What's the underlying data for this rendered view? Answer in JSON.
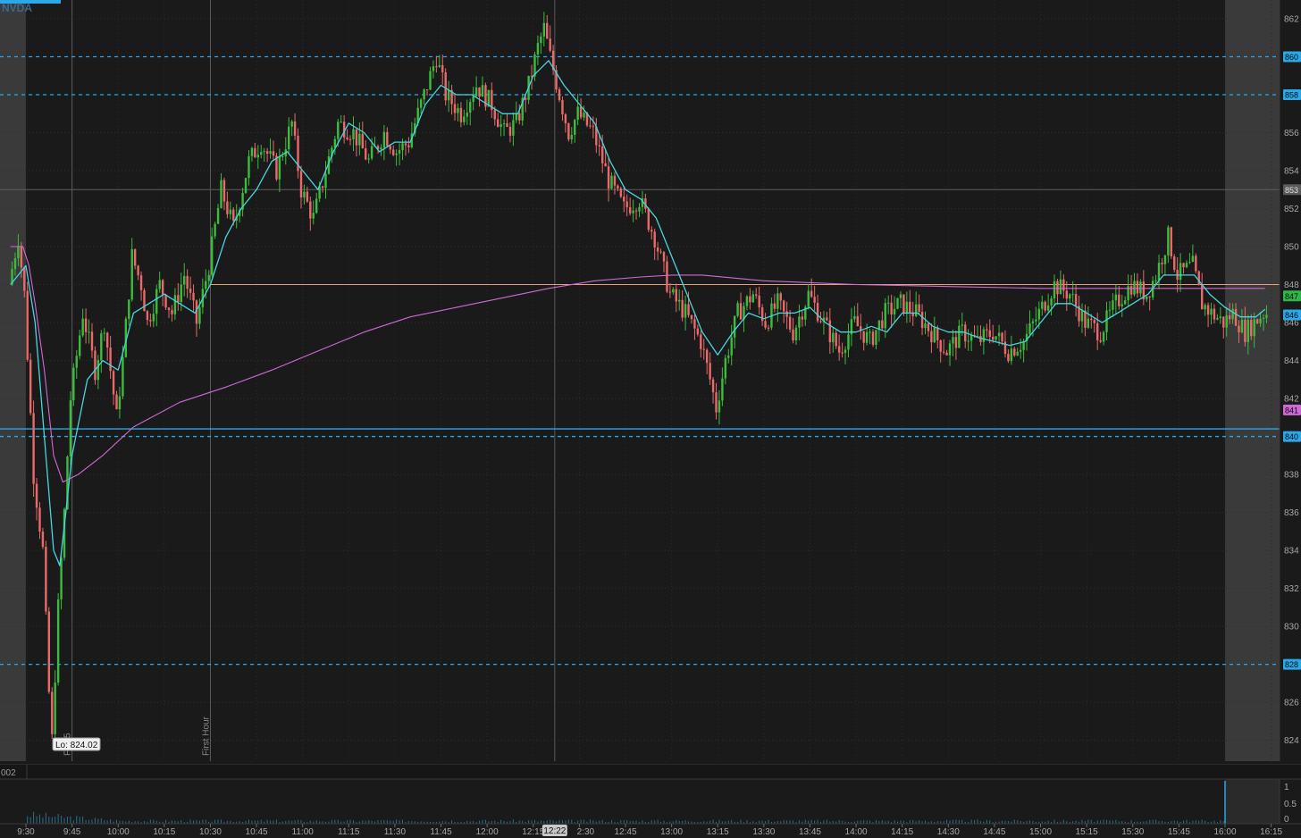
{
  "symbol": "NVDA",
  "colors": {
    "background": "#1a1a1a",
    "session_shade": "#3a3a3a",
    "up_candle": "#3dbb3d",
    "down_candle": "#e86a6a",
    "ema": "#46d6e0",
    "vwap": "#d069d6",
    "level": "#2aa8e8",
    "orange_line": "#e8a07a"
  },
  "chart_data": {
    "type": "candlestick",
    "ylim": [
      822.9,
      862.8
    ],
    "yticks": [
      824,
      826,
      828,
      830,
      832,
      834,
      836,
      838,
      840,
      842,
      844,
      846,
      848,
      850,
      852,
      854,
      856,
      858,
      860,
      862
    ],
    "xticks": [
      "9:30",
      "9:45",
      "10:00",
      "10:15",
      "10:30",
      "10:45",
      "11:00",
      "11:15",
      "11:30",
      "11:45",
      "12:00",
      "12:15",
      "12:30",
      "12:45",
      "13:00",
      "13:15",
      "13:30",
      "13:45",
      "14:00",
      "14:15",
      "14:30",
      "14:45",
      "15:00",
      "15:15",
      "15:30",
      "15:45",
      "16:00",
      "16:15"
    ],
    "x_session_start": "9:30",
    "x_session_end": "16:00",
    "candle_minutes": 1,
    "price_path": [
      [
        "9:25",
        848.0
      ],
      [
        "9:28",
        850.5
      ],
      [
        "9:30",
        847.5
      ],
      [
        "9:33",
        838.0
      ],
      [
        "9:36",
        834.0
      ],
      [
        "9:38",
        826.5
      ],
      [
        "9:39",
        824.02
      ],
      [
        "9:41",
        831.0
      ],
      [
        "9:43",
        836.0
      ],
      [
        "9:45",
        842.0
      ],
      [
        "9:49",
        846.5
      ],
      [
        "9:53",
        843.5
      ],
      [
        "9:56",
        846.0
      ],
      [
        "10:00",
        841.0
      ],
      [
        "10:02",
        844.0
      ],
      [
        "10:05",
        849.5
      ],
      [
        "10:08",
        848.0
      ],
      [
        "10:10",
        846.0
      ],
      [
        "10:14",
        848.0
      ],
      [
        "10:18",
        846.5
      ],
      [
        "10:22",
        848.5
      ],
      [
        "10:26",
        846.0
      ],
      [
        "10:30",
        849.0
      ],
      [
        "10:34",
        853.0
      ],
      [
        "10:38",
        851.0
      ],
      [
        "10:43",
        854.5
      ],
      [
        "10:47",
        855.5
      ],
      [
        "10:52",
        854.0
      ],
      [
        "10:57",
        856.5
      ],
      [
        "11:00",
        853.0
      ],
      [
        "11:04",
        851.5
      ],
      [
        "11:08",
        854.0
      ],
      [
        "11:12",
        856.5
      ],
      [
        "11:17",
        856.0
      ],
      [
        "11:22",
        854.5
      ],
      [
        "11:27",
        856.0
      ],
      [
        "11:31",
        855.0
      ],
      [
        "11:35",
        855.5
      ],
      [
        "11:40",
        858.0
      ],
      [
        "11:44",
        860.0
      ],
      [
        "11:47",
        858.0
      ],
      [
        "11:52",
        857.0
      ],
      [
        "11:57",
        858.5
      ],
      [
        "12:02",
        857.5
      ],
      [
        "12:06",
        856.0
      ],
      [
        "12:10",
        856.5
      ],
      [
        "12:14",
        858.5
      ],
      [
        "12:17",
        860.5
      ],
      [
        "12:19",
        861.5
      ],
      [
        "12:21",
        860.0
      ],
      [
        "12:24",
        858.0
      ],
      [
        "12:27",
        856.0
      ],
      [
        "12:30",
        857.0
      ],
      [
        "12:35",
        856.0
      ],
      [
        "12:40",
        853.5
      ],
      [
        "12:45",
        852.0
      ],
      [
        "12:50",
        852.5
      ],
      [
        "12:55",
        850.5
      ],
      [
        "13:00",
        847.5
      ],
      [
        "13:05",
        846.5
      ],
      [
        "13:10",
        845.0
      ],
      [
        "13:13",
        843.0
      ],
      [
        "13:15",
        841.5
      ],
      [
        "13:18",
        844.0
      ],
      [
        "13:22",
        846.5
      ],
      [
        "13:27",
        847.5
      ],
      [
        "13:31",
        846.0
      ],
      [
        "13:35",
        847.0
      ],
      [
        "13:40",
        845.5
      ],
      [
        "13:45",
        847.5
      ],
      [
        "13:50",
        846.0
      ],
      [
        "13:55",
        844.5
      ],
      [
        "14:00",
        846.0
      ],
      [
        "14:05",
        845.0
      ],
      [
        "14:10",
        846.5
      ],
      [
        "14:15",
        847.0
      ],
      [
        "14:20",
        846.5
      ],
      [
        "14:25",
        845.5
      ],
      [
        "14:30",
        844.5
      ],
      [
        "14:35",
        845.5
      ],
      [
        "14:40",
        845.0
      ],
      [
        "14:45",
        845.5
      ],
      [
        "14:50",
        844.5
      ],
      [
        "14:55",
        845.0
      ],
      [
        "15:00",
        846.5
      ],
      [
        "15:05",
        848.0
      ],
      [
        "15:10",
        847.5
      ],
      [
        "15:15",
        846.0
      ],
      [
        "15:20",
        845.5
      ],
      [
        "15:25",
        847.0
      ],
      [
        "15:30",
        848.0
      ],
      [
        "15:35",
        847.5
      ],
      [
        "15:38",
        848.5
      ],
      [
        "15:42",
        850.5
      ],
      [
        "15:45",
        848.5
      ],
      [
        "15:50",
        849.0
      ],
      [
        "15:53",
        847.0
      ],
      [
        "15:56",
        846.5
      ],
      [
        "16:00",
        846.0
      ],
      [
        "16:03",
        846.5
      ],
      [
        "16:07",
        845.5
      ],
      [
        "16:10",
        846.0
      ],
      [
        "16:13",
        846.5
      ]
    ],
    "ema_path": [
      [
        "9:25",
        848.0
      ],
      [
        "9:30",
        849.0
      ],
      [
        "9:33",
        846.0
      ],
      [
        "9:36",
        840.0
      ],
      [
        "9:39",
        834.0
      ],
      [
        "9:41",
        833.2
      ],
      [
        "9:43",
        836.0
      ],
      [
        "9:45",
        839.0
      ],
      [
        "9:50",
        843.0
      ],
      [
        "9:55",
        844.0
      ],
      [
        "10:00",
        843.5
      ],
      [
        "10:05",
        846.5
      ],
      [
        "10:10",
        847.0
      ],
      [
        "10:15",
        847.5
      ],
      [
        "10:20",
        847.0
      ],
      [
        "10:25",
        846.5
      ],
      [
        "10:30",
        848.0
      ],
      [
        "10:35",
        850.5
      ],
      [
        "10:40",
        852.0
      ],
      [
        "10:45",
        853.0
      ],
      [
        "10:50",
        854.5
      ],
      [
        "10:55",
        855.0
      ],
      [
        "11:00",
        854.0
      ],
      [
        "11:05",
        853.0
      ],
      [
        "11:10",
        855.0
      ],
      [
        "11:15",
        856.5
      ],
      [
        "11:20",
        856.0
      ],
      [
        "11:25",
        855.0
      ],
      [
        "11:30",
        855.5
      ],
      [
        "11:35",
        855.5
      ],
      [
        "11:40",
        857.5
      ],
      [
        "11:45",
        858.5
      ],
      [
        "11:50",
        858.0
      ],
      [
        "11:55",
        858.0
      ],
      [
        "12:00",
        857.5
      ],
      [
        "12:05",
        857.0
      ],
      [
        "12:10",
        857.0
      ],
      [
        "12:15",
        859.0
      ],
      [
        "12:20",
        859.8
      ],
      [
        "12:25",
        858.5
      ],
      [
        "12:30",
        857.5
      ],
      [
        "12:35",
        856.5
      ],
      [
        "12:40",
        854.5
      ],
      [
        "12:45",
        853.0
      ],
      [
        "12:50",
        852.5
      ],
      [
        "12:55",
        851.5
      ],
      [
        "13:00",
        849.5
      ],
      [
        "13:05",
        847.5
      ],
      [
        "13:10",
        845.5
      ],
      [
        "13:15",
        844.3
      ],
      [
        "13:20",
        845.5
      ],
      [
        "13:25",
        846.5
      ],
      [
        "13:30",
        846.2
      ],
      [
        "13:35",
        846.5
      ],
      [
        "13:40",
        846.5
      ],
      [
        "13:45",
        846.8
      ],
      [
        "13:50",
        846.0
      ],
      [
        "13:55",
        845.5
      ],
      [
        "14:00",
        845.5
      ],
      [
        "14:05",
        845.8
      ],
      [
        "14:10",
        845.5
      ],
      [
        "14:15",
        846.5
      ],
      [
        "14:20",
        846.5
      ],
      [
        "14:25",
        845.8
      ],
      [
        "14:30",
        845.5
      ],
      [
        "14:35",
        845.5
      ],
      [
        "14:40",
        845.2
      ],
      [
        "14:45",
        845.0
      ],
      [
        "14:50",
        844.8
      ],
      [
        "14:55",
        845.0
      ],
      [
        "15:00",
        846.0
      ],
      [
        "15:05",
        847.0
      ],
      [
        "15:10",
        847.0
      ],
      [
        "15:15",
        846.5
      ],
      [
        "15:20",
        846.0
      ],
      [
        "15:25",
        846.5
      ],
      [
        "15:30",
        847.0
      ],
      [
        "15:35",
        847.5
      ],
      [
        "15:40",
        848.5
      ],
      [
        "15:45",
        848.5
      ],
      [
        "15:50",
        848.5
      ],
      [
        "15:55",
        847.5
      ],
      [
        "16:00",
        846.8
      ],
      [
        "16:05",
        846.3
      ],
      [
        "16:10",
        846.3
      ],
      [
        "16:13",
        846.7
      ]
    ],
    "vwap_path": [
      [
        "9:25",
        850.0
      ],
      [
        "9:29",
        850.0
      ],
      [
        "9:31",
        849.0
      ],
      [
        "9:33",
        847.0
      ],
      [
        "9:36",
        843.5
      ],
      [
        "9:39",
        839.0
      ],
      [
        "9:42",
        837.6
      ],
      [
        "9:47",
        838.0
      ],
      [
        "9:55",
        839.0
      ],
      [
        "10:05",
        840.5
      ],
      [
        "10:20",
        841.8
      ],
      [
        "10:35",
        842.6
      ],
      [
        "10:50",
        843.5
      ],
      [
        "11:05",
        844.5
      ],
      [
        "11:20",
        845.5
      ],
      [
        "11:35",
        846.3
      ],
      [
        "11:50",
        846.8
      ],
      [
        "12:05",
        847.3
      ],
      [
        "12:20",
        847.8
      ],
      [
        "12:35",
        848.2
      ],
      [
        "12:50",
        848.4
      ],
      [
        "13:00",
        848.5
      ],
      [
        "13:10",
        848.5
      ],
      [
        "13:30",
        848.2
      ],
      [
        "14:00",
        848.0
      ],
      [
        "14:30",
        847.9
      ],
      [
        "15:00",
        847.8
      ],
      [
        "15:30",
        847.8
      ],
      [
        "16:00",
        847.8
      ],
      [
        "16:13",
        847.8
      ]
    ],
    "horizontal_levels": [
      {
        "price": 860,
        "style": "dashed",
        "label": "860"
      },
      {
        "price": 858,
        "style": "dashed",
        "label": "858"
      },
      {
        "price": 840,
        "style": "dashed",
        "label": "840"
      },
      {
        "price": 828,
        "style": "dashed",
        "label": "828"
      },
      {
        "price": 840.4,
        "style": "solid"
      }
    ],
    "orange_level": 848.0,
    "gray_level": 853.0,
    "price_badges": [
      {
        "price": 853,
        "label": "853",
        "bg": "#5a5a5a",
        "fg": "#e0e0e0"
      },
      {
        "price": 847.4,
        "label": "847",
        "bg": "#2fb84a",
        "fg": "#0a0a0a"
      },
      {
        "price": 846.4,
        "label": "846",
        "bg": "#2aa8e8",
        "fg": "#0a0a0a"
      },
      {
        "price": 841.4,
        "label": "841",
        "bg": "#d069d6",
        "fg": "#0a0a0a"
      }
    ],
    "low_annotation": {
      "label": "Lo: 824.02",
      "time": "9:39",
      "price": 824.02
    },
    "vertical_markers": [
      {
        "time": "9:45",
        "label": "Fri 15"
      },
      {
        "time": "10:30",
        "label": "First Hour"
      },
      {
        "time": "12:22",
        "label": ""
      }
    ],
    "crosshair_time_label": "12:22",
    "volume_pane": {
      "label": "002",
      "yticks": [
        "1",
        "0.5",
        "0"
      ],
      "spike_time": "16:00"
    }
  }
}
